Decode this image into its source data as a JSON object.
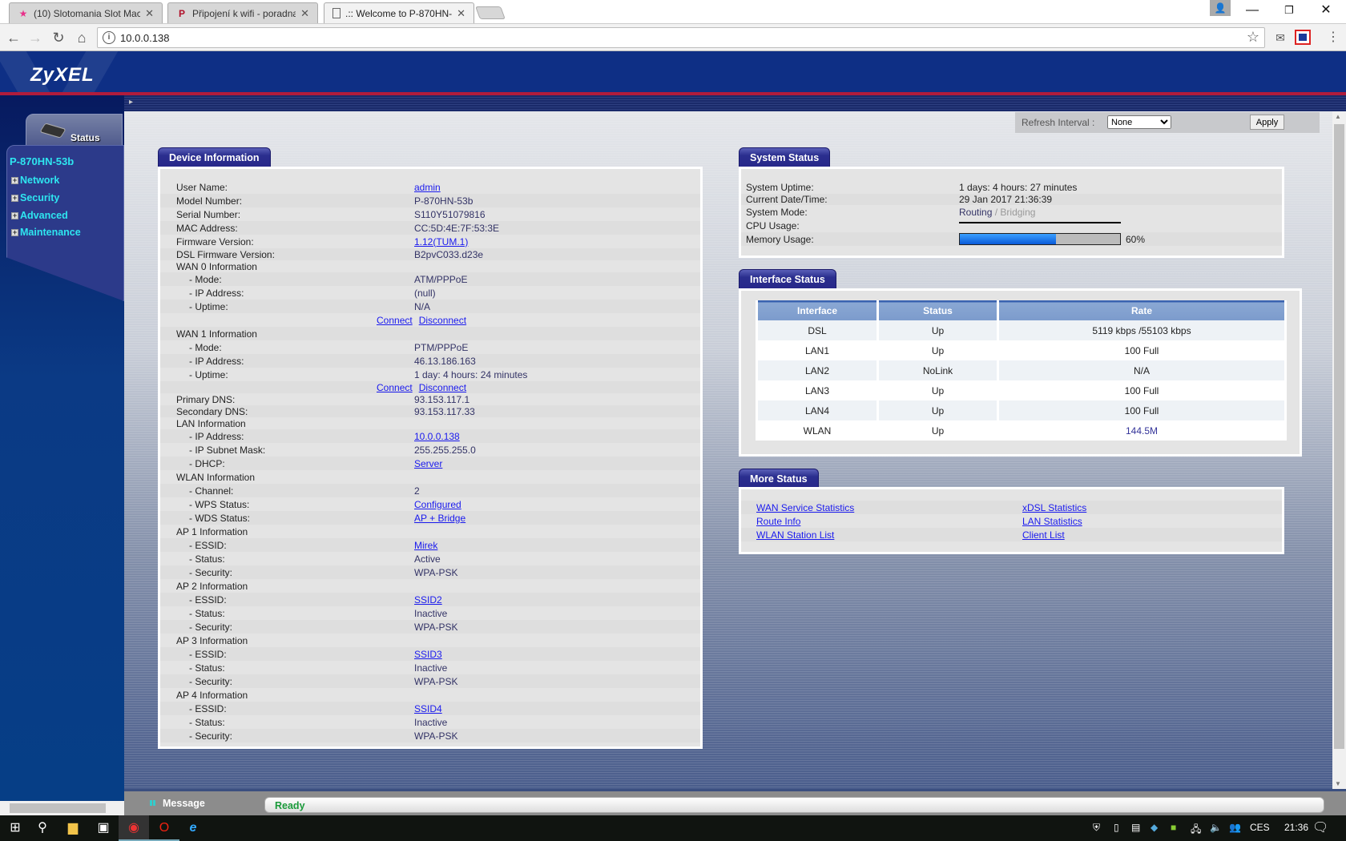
{
  "browser": {
    "tabs": [
      {
        "title": "(10) Slotomania Slot Mac",
        "icon": "star-favicon-icon",
        "active": false
      },
      {
        "title": "Připojení k wifi - poradna",
        "icon": "pnet-favicon-icon",
        "active": false
      },
      {
        "title": ".:: Welcome to P-870HN-",
        "icon": "page-icon",
        "active": true
      }
    ],
    "url": "10.0.0.138"
  },
  "brand": {
    "logo": "ZyXEL"
  },
  "sidebar": {
    "tab_label": "Status",
    "model": "P-870HN-53b",
    "items": [
      {
        "label": "Network"
      },
      {
        "label": "Security"
      },
      {
        "label": "Advanced"
      },
      {
        "label": "Maintenance"
      }
    ]
  },
  "refresh": {
    "label": "Refresh Interval :",
    "selected": "None",
    "apply": "Apply"
  },
  "device_info": {
    "title": "Device Information",
    "rows": [
      {
        "label": "User Name:",
        "value": "admin",
        "link": true
      },
      {
        "label": "Model Number:",
        "value": "P-870HN-53b"
      },
      {
        "label": "Serial Number:",
        "value": "S110Y51079816"
      },
      {
        "label": "MAC Address:",
        "value": "CC:5D:4E:7F:53:3E"
      },
      {
        "label": "Firmware Version:",
        "value": "1.12(TUM.1)",
        "link": true
      },
      {
        "label": "DSL Firmware Version:",
        "value": "B2pvC033.d23e",
        "compact": true
      },
      {
        "label": "WAN 0 Information",
        "compact": true
      },
      {
        "label": "- Mode:",
        "value": "ATM/PPPoE",
        "indent": true
      },
      {
        "label": "- IP Address:",
        "value": "(null)",
        "indent": true
      },
      {
        "label": "- Uptime:",
        "value": "N/A",
        "indent": true
      },
      {
        "actions": [
          "Connect",
          "Disconnect"
        ]
      },
      {
        "label": "WAN 1 Information"
      },
      {
        "label": "- Mode:",
        "value": "PTM/PPPoE",
        "indent": true
      },
      {
        "label": "- IP Address:",
        "value": "46.13.186.163",
        "indent": true
      },
      {
        "label": "- Uptime:",
        "value": "1 day: 4 hours: 24 minutes",
        "indent": true
      },
      {
        "actions": [
          "Connect",
          "Disconnect"
        ],
        "compact": true
      },
      {
        "label": "Primary DNS:",
        "value": "93.153.117.1",
        "compact": true
      },
      {
        "label": "Secondary DNS:",
        "value": "93.153.117.33",
        "compact": true
      },
      {
        "label": "LAN Information",
        "compact": true
      },
      {
        "label": "- IP Address:",
        "value": "10.0.0.138",
        "link": true,
        "indent": true
      },
      {
        "label": "- IP Subnet Mask:",
        "value": "255.255.255.0",
        "indent": true
      },
      {
        "label": "- DHCP:",
        "value": "Server",
        "link": true,
        "indent": true
      },
      {
        "label": "WLAN Information"
      },
      {
        "label": "- Channel:",
        "value": "2",
        "indent": true
      },
      {
        "label": "- WPS Status:",
        "value": "Configured",
        "link": true,
        "indent": true
      },
      {
        "label": "- WDS Status:",
        "value": "AP + Bridge",
        "link": true,
        "indent": true
      },
      {
        "label": "AP 1 Information"
      },
      {
        "label": "- ESSID:",
        "value": "Mirek",
        "link": true,
        "indent": true
      },
      {
        "label": "- Status:",
        "value": "Active",
        "indent": true
      },
      {
        "label": "- Security:",
        "value": "WPA-PSK",
        "indent": true
      },
      {
        "label": "AP 2 Information"
      },
      {
        "label": "- ESSID:",
        "value": "SSID2",
        "link": true,
        "indent": true
      },
      {
        "label": "- Status:",
        "value": "Inactive",
        "indent": true
      },
      {
        "label": "- Security:",
        "value": "WPA-PSK",
        "indent": true
      },
      {
        "label": "AP 3 Information"
      },
      {
        "label": "- ESSID:",
        "value": "SSID3",
        "link": true,
        "indent": true
      },
      {
        "label": "- Status:",
        "value": "Inactive",
        "indent": true
      },
      {
        "label": "- Security:",
        "value": "WPA-PSK",
        "indent": true
      },
      {
        "label": "AP 4 Information"
      },
      {
        "label": "- ESSID:",
        "value": "SSID4",
        "link": true,
        "indent": true
      },
      {
        "label": "- Status:",
        "value": "Inactive",
        "indent": true
      },
      {
        "label": "- Security:",
        "value": "WPA-PSK",
        "indent": true
      }
    ]
  },
  "system_status": {
    "title": "System Status",
    "uptime_label": "System Uptime:",
    "uptime": "1 days: 4 hours: 27 minutes",
    "datetime_label": "Current Date/Time:",
    "datetime": "29 Jan 2017 21:36:39",
    "mode_label": "System Mode:",
    "mode_routing": "Routing",
    "mode_sep": "/",
    "mode_bridging": "Bridging",
    "cpu_label": "CPU Usage:",
    "cpu_percent": 0,
    "memory_label": "Memory Usage:",
    "memory_percent": 60,
    "memory_text": "60%",
    "bar_color": "#0a6ee8"
  },
  "interface_status": {
    "title": "Interface Status",
    "columns": [
      "Interface",
      "Status",
      "Rate"
    ],
    "rows": [
      [
        "DSL",
        "Up",
        "5119 kbps /55103 kbps"
      ],
      [
        "LAN1",
        "Up",
        "100 Full"
      ],
      [
        "LAN2",
        "NoLink",
        "N/A"
      ],
      [
        "LAN3",
        "Up",
        "100 Full"
      ],
      [
        "LAN4",
        "Up",
        "100 Full"
      ],
      [
        "WLAN",
        "Up",
        "144.5M"
      ]
    ]
  },
  "more_status": {
    "title": "More Status",
    "links": [
      [
        "WAN Service Statistics",
        "xDSL Statistics"
      ],
      [
        "Route Info",
        "LAN Statistics"
      ],
      [
        "WLAN Station List",
        "Client List"
      ]
    ]
  },
  "statusbar": {
    "message_label": "Message",
    "status": "Ready"
  },
  "taskbar": {
    "language": "CES",
    "time": "21:36"
  }
}
